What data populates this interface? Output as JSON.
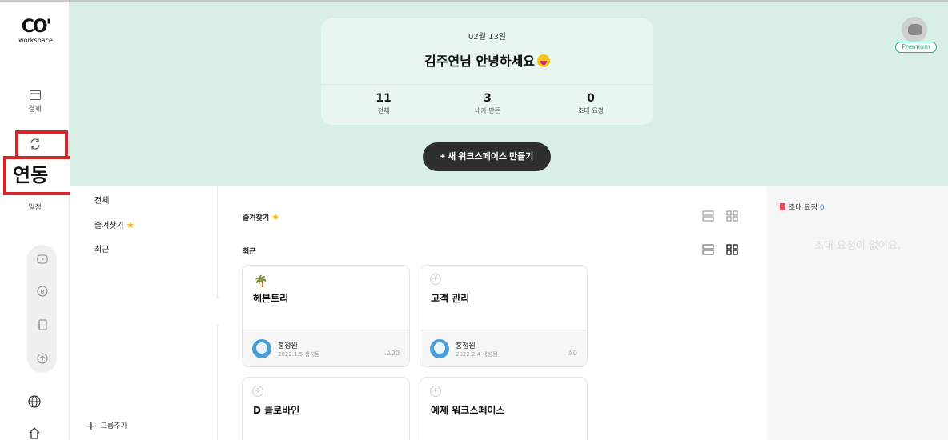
{
  "brand": {
    "logo_mark": "CO'",
    "logo_text": "workspace"
  },
  "rail": {
    "items": [
      {
        "label": "결제",
        "icon": "card-icon"
      },
      {
        "label": "",
        "icon": "sync-icon"
      },
      {
        "label": "일정",
        "icon": "calendar-icon"
      }
    ],
    "pill_icons": [
      "play-icon",
      "bitcoin-icon",
      "notebook-icon",
      "upload-icon"
    ],
    "bottom_icons": [
      "globe-icon",
      "home-icon"
    ]
  },
  "highlight": {
    "label": "연동"
  },
  "hero": {
    "date": "02월 13일",
    "greeting": "김주연님 안녕하세요",
    "stats": [
      {
        "value": "11",
        "label": "전체"
      },
      {
        "value": "3",
        "label": "내가 만든"
      },
      {
        "value": "0",
        "label": "초대 요청"
      }
    ],
    "new_button": "+ 새 워크스페이스 만들기"
  },
  "profile": {
    "badge": "Premium"
  },
  "groups": {
    "items": [
      "전체",
      "즐겨찾기",
      "최근"
    ],
    "add_label": "그룹추가"
  },
  "main": {
    "favorites_title": "즐겨찾기",
    "recent_title": "최근",
    "cards": [
      {
        "icon": "palm-tree-icon",
        "name": "헤븐트리",
        "owner": "홍정원",
        "created": "2022.1.5 생성됨",
        "members": "20"
      },
      {
        "icon": "plus-icon",
        "name": "고객 관리",
        "owner": "홍정원",
        "created": "2022.2.4 생성됨",
        "members": "0"
      },
      {
        "icon": "plus-icon",
        "name": "D 클로바인"
      },
      {
        "icon": "plus-icon",
        "name": "예제 워크스페이스"
      }
    ]
  },
  "invite": {
    "title": "초대 요청",
    "count": "0",
    "empty_text": "초대 요청이 없어요."
  },
  "colors": {
    "banner": "#d7efe5",
    "accent_green": "#1ea672",
    "highlight_red": "#d8232a",
    "link_blue": "#2f86e6"
  }
}
